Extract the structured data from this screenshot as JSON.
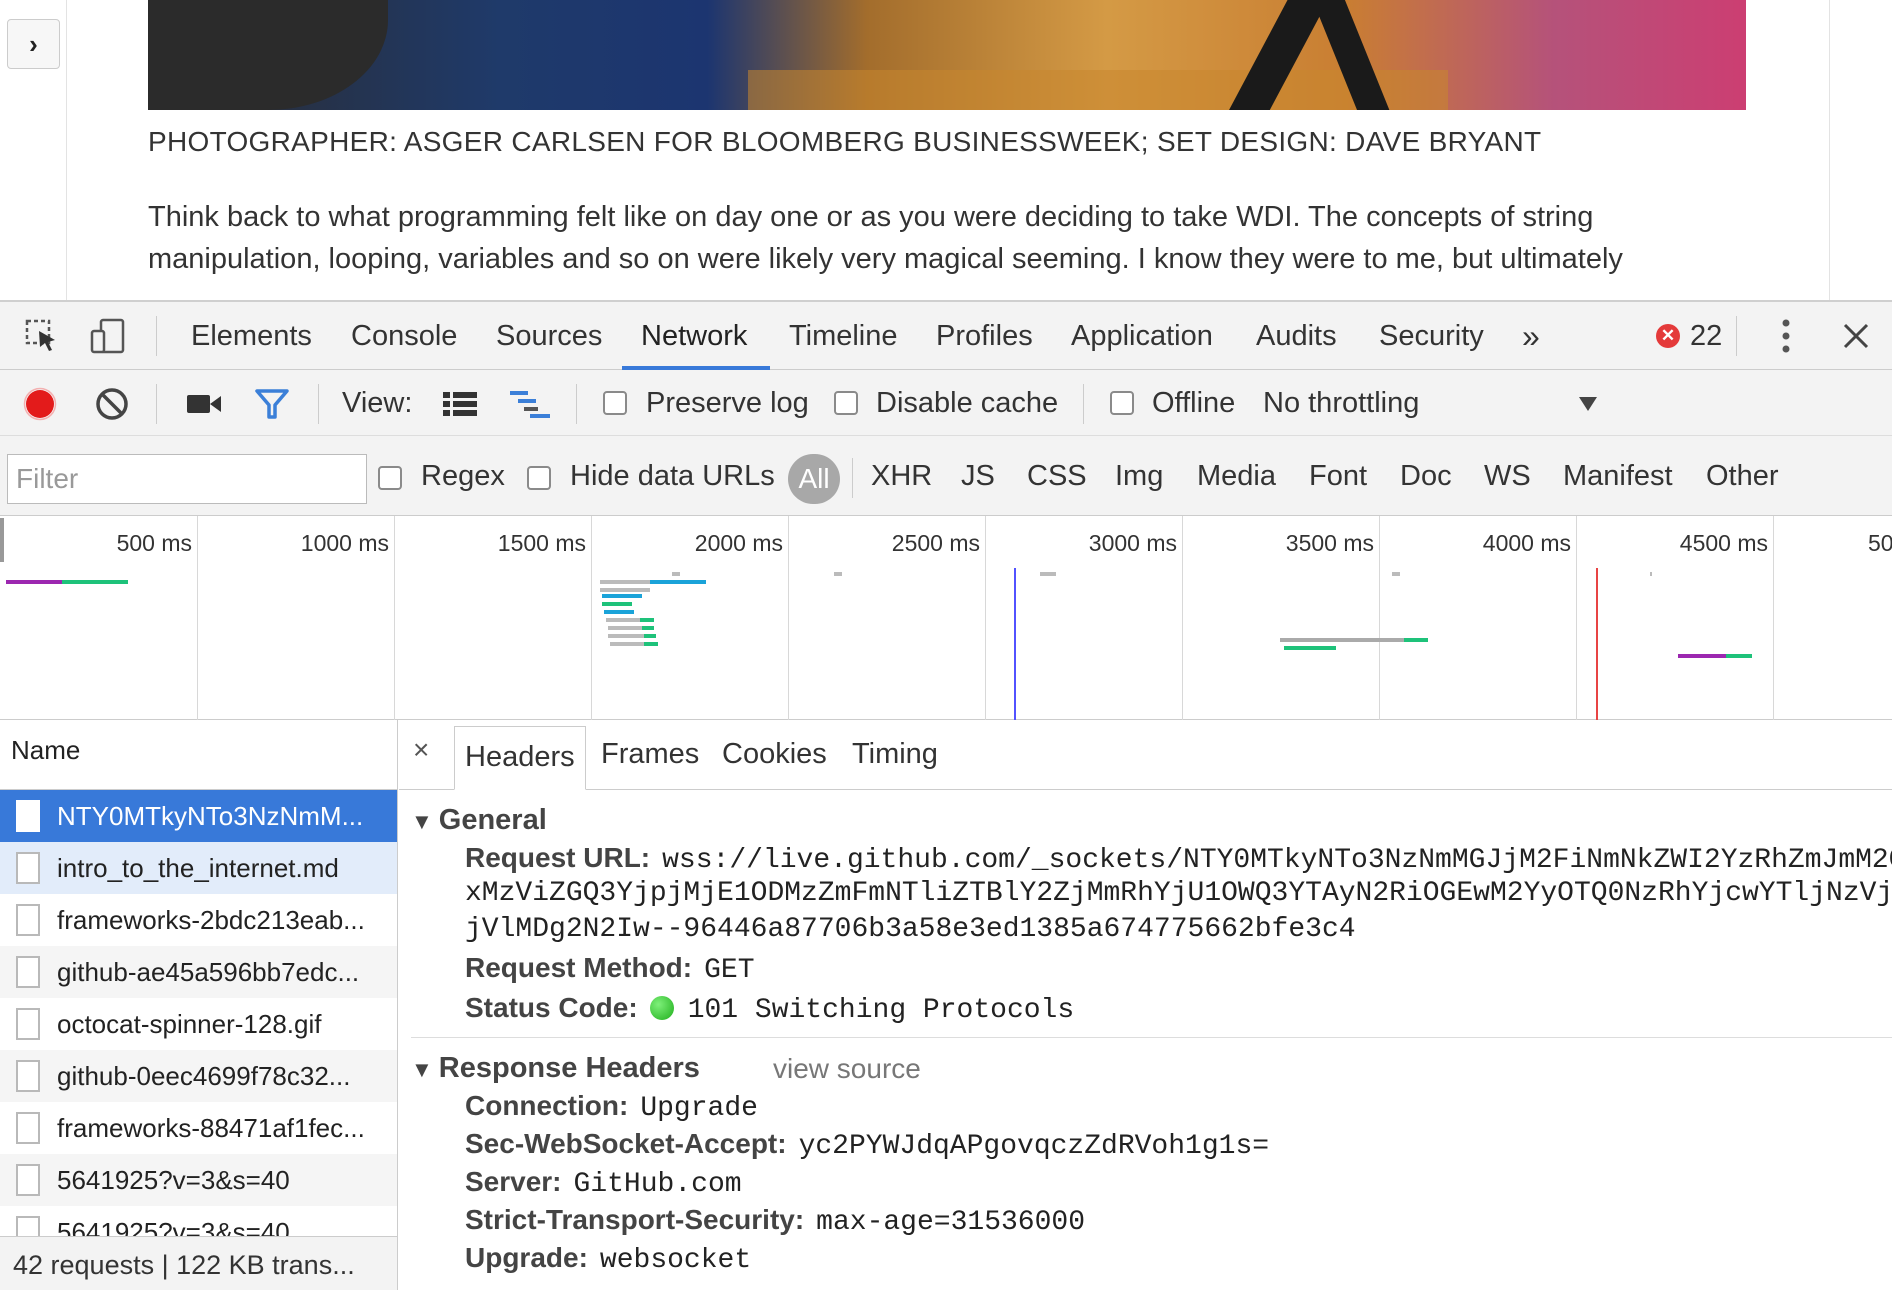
{
  "page": {
    "expand_label": "›",
    "caption": "PHOTOGRAPHER: ASGER CARLSEN FOR BLOOMBERG BUSINESSWEEK; SET DESIGN: DAVE BRYANT",
    "text_line1": "Think back to what programming felt like on day one or as you were deciding to take WDI. The concepts of string",
    "text_line2": "manipulation, looping, variables and so on were likely very magical seeming. I know they were to me, but ultimately"
  },
  "devtools": {
    "tabs": [
      "Elements",
      "Console",
      "Sources",
      "Network",
      "Timeline",
      "Profiles",
      "Application",
      "Audits",
      "Security"
    ],
    "active_tab": "Network",
    "more_tabs": "»",
    "error_count": "22",
    "toolbar": {
      "view_label": "View:",
      "preserve_log": "Preserve log",
      "disable_cache": "Disable cache",
      "offline": "Offline",
      "throttling": "No throttling"
    },
    "filterbar": {
      "filter_placeholder": "Filter",
      "regex": "Regex",
      "hide_data_urls": "Hide data URLs",
      "types": [
        "All",
        "XHR",
        "JS",
        "CSS",
        "Img",
        "Media",
        "Font",
        "Doc",
        "WS",
        "Manifest",
        "Other"
      ],
      "active_type": "All"
    },
    "overview": {
      "ticks": [
        "500 ms",
        "1000 ms",
        "1500 ms",
        "2000 ms",
        "2500 ms",
        "3000 ms",
        "3500 ms",
        "4000 ms",
        "4500 ms",
        "50"
      ]
    },
    "requests": {
      "header": "Name",
      "rows": [
        "NTY0MTkyNTo3NzNmM...",
        "intro_to_the_internet.md",
        "frameworks-2bdc213eab...",
        "github-ae45a596bb7edc...",
        "octocat-spinner-128.gif",
        "github-0eec4699f78c32...",
        "frameworks-88471af1fec...",
        "5641925?v=3&s=40",
        "5641925?v=3&s=40"
      ],
      "footer": "42 requests  |  122 KB trans..."
    },
    "detail": {
      "close": "×",
      "tabs": [
        "Headers",
        "Frames",
        "Cookies",
        "Timing"
      ],
      "active_tab": "Headers",
      "general": {
        "title": "General",
        "request_url_label": "Request URL:",
        "request_url_line1": "wss://live.github.com/_sockets/NTY0MTkyNTo3NzNmMGJjM2FiNmNkZWI2YzRhZmJmM2Q",
        "request_url_line2": "xMzViZGQ3YjpjMjE1ODMzZmFmNTliZTBlY2ZjMmRhYjU1OWQ3YTAyN2RiOGEwM2YyOTQ0NzRhYjcwYTljNzVjZ",
        "request_url_line3": "jVlMDg2N2Iw--96446a87706b3a58e3ed1385a674775662bfe3c4",
        "method_label": "Request Method:",
        "method": "GET",
        "status_label": "Status Code:",
        "status": "101 Switching Protocols"
      },
      "response": {
        "title": "Response Headers",
        "view_source": "view source",
        "headers": [
          {
            "k": "Connection:",
            "v": "Upgrade"
          },
          {
            "k": "Sec-WebSocket-Accept:",
            "v": "yc2PYWJdqAPgovqczZdRVoh1g1s="
          },
          {
            "k": "Server:",
            "v": "GitHub.com"
          },
          {
            "k": "Strict-Transport-Security:",
            "v": "max-age=31536000"
          },
          {
            "k": "Upgrade:",
            "v": "websocket"
          }
        ]
      }
    }
  }
}
